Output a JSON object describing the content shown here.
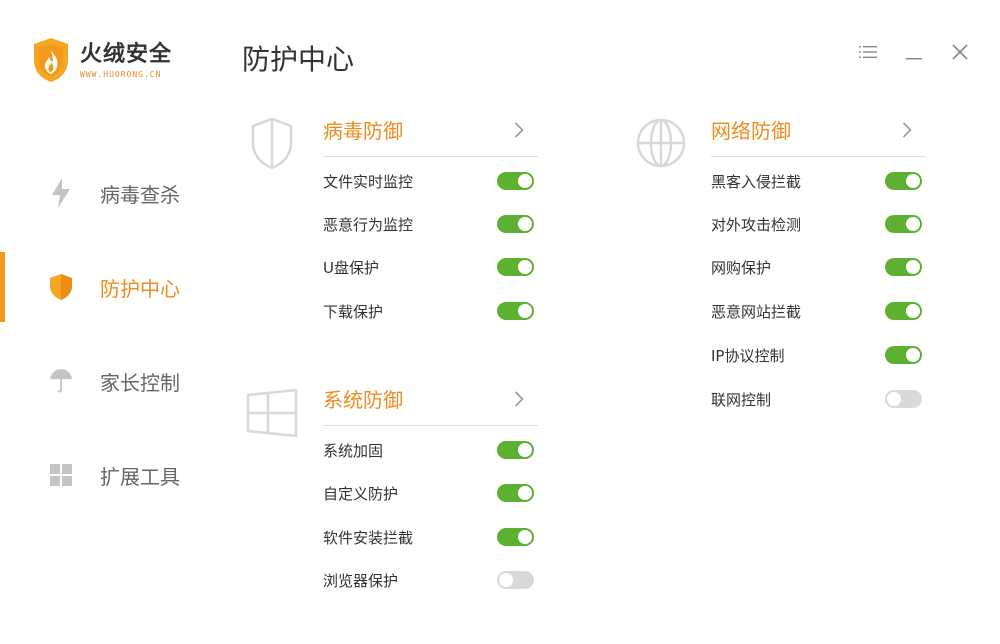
{
  "app": {
    "name": "火绒安全",
    "url": "WWW.HUORONG.CN",
    "accent": "#f08c1f",
    "toggle_on": "#5cb130",
    "toggle_off": "#d9d9d9"
  },
  "page_title": "防护中心",
  "window_controls": [
    {
      "name": "menu-icon"
    },
    {
      "name": "minimize-icon"
    },
    {
      "name": "close-icon"
    }
  ],
  "sidebar": {
    "items": [
      {
        "label": "病毒查杀",
        "icon": "lightning-icon",
        "active": false
      },
      {
        "label": "防护中心",
        "icon": "shield-icon",
        "active": true
      },
      {
        "label": "家长控制",
        "icon": "umbrella-icon",
        "active": false
      },
      {
        "label": "扩展工具",
        "icon": "grid-icon",
        "active": false
      }
    ]
  },
  "sections": {
    "virus": {
      "title": "病毒防御",
      "icon": "shield-outline-icon",
      "items": [
        {
          "label": "文件实时监控",
          "on": true
        },
        {
          "label": "恶意行为监控",
          "on": true
        },
        {
          "label": "U盘保护",
          "on": true
        },
        {
          "label": "下载保护",
          "on": true
        }
      ]
    },
    "system": {
      "title": "系统防御",
      "icon": "windows-icon",
      "items": [
        {
          "label": "系统加固",
          "on": true
        },
        {
          "label": "自定义防护",
          "on": true
        },
        {
          "label": "软件安装拦截",
          "on": true
        },
        {
          "label": "浏览器保护",
          "on": false
        }
      ]
    },
    "network": {
      "title": "网络防御",
      "icon": "globe-icon",
      "items": [
        {
          "label": "黑客入侵拦截",
          "on": true
        },
        {
          "label": "对外攻击检测",
          "on": true
        },
        {
          "label": "网购保护",
          "on": true
        },
        {
          "label": "恶意网站拦截",
          "on": true
        },
        {
          "label": "IP协议控制",
          "on": true
        },
        {
          "label": "联网控制",
          "on": false
        }
      ]
    }
  }
}
